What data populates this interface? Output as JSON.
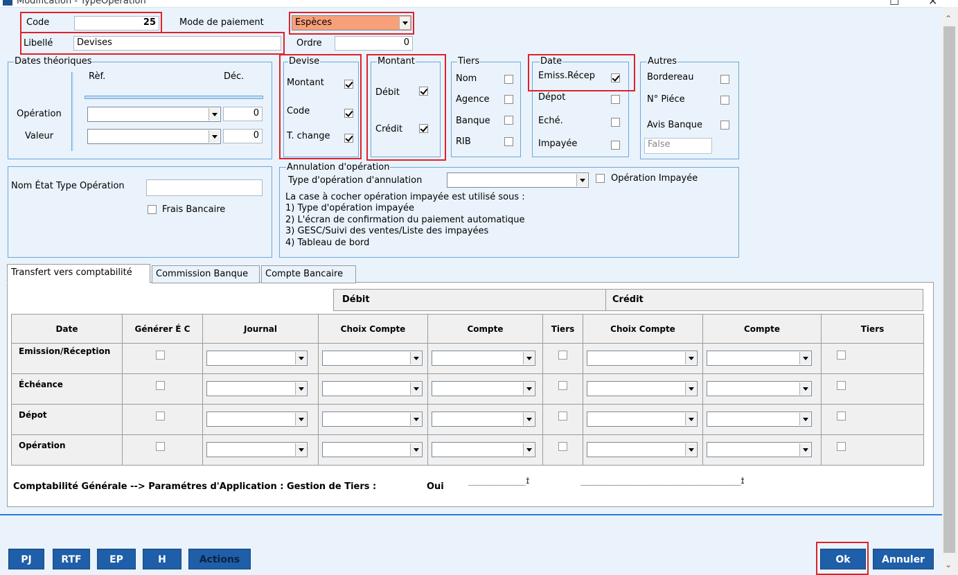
{
  "window": {
    "title": "Modification - TypeOpération",
    "minimize_icon": "minimize-icon",
    "close_icon": "close-icon"
  },
  "header": {
    "code_label": "Code",
    "code_value": "25",
    "mode_label": "Mode de paiement",
    "mode_value": "Espèces",
    "libelle_label": "Libellé",
    "libelle_value": "Devises",
    "ordre_label": "Ordre",
    "ordre_value": "0"
  },
  "dates_theoriques": {
    "legend": "Dates théoriques",
    "ref_label": "Rèf.",
    "dec_label": "Déc.",
    "operation_label": "Opération",
    "operation_dec": "0",
    "valeur_label": "Valeur",
    "valeur_dec": "0"
  },
  "devise": {
    "legend": "Devise",
    "montant_label": "Montant",
    "code_label": "Code",
    "tchange_label": "T. change"
  },
  "montant": {
    "legend": "Montant",
    "debit_label": "Débit",
    "credit_label": "Crédit"
  },
  "tiers": {
    "legend": "Tiers",
    "nom_label": "Nom",
    "agence_label": "Agence",
    "banque_label": "Banque",
    "rib_label": "RIB"
  },
  "date_group": {
    "legend": "Date",
    "emiss_label": "Emiss.Récep",
    "depot_label": "Dépot",
    "eche_label": "Eché.",
    "impayee_label": "Impayée"
  },
  "autres": {
    "legend": "Autres",
    "bordereau_label": "Bordereau",
    "piece_label": "N° Piéce",
    "avis_label": "Avis Banque",
    "avis_value": "False"
  },
  "etat": {
    "nom_label": "Nom État Type Opération",
    "frais_label": "Frais Bancaire"
  },
  "annulation": {
    "legend": "Annulation d'opération",
    "type_label": "Type d'opération d'annulation",
    "impayee_label": "Opération Impayée",
    "note_1": "La case à cocher opération impayée est utilisé sous :",
    "note_2": "1) Type d'opération impayée",
    "note_3": "2) L'écran de confirmation du paiement automatique",
    "note_4": "3) GESC/Suivi des ventes/Liste des impayées",
    "note_5": "4) Tableau de bord"
  },
  "tabs": [
    {
      "label": "Transfert vers comptabilité"
    },
    {
      "label": "Commission Banque"
    },
    {
      "label": "Compte Bancaire"
    }
  ],
  "grid": {
    "debit_header": "Débit",
    "credit_header": "Crédit",
    "columns": [
      "Date",
      "Générer É C",
      "Journal",
      "Choix Compte",
      "Compte",
      "Tiers",
      "Choix Compte",
      "Compte",
      "Tiers"
    ],
    "rows": [
      "Emission/Réception",
      "Échéance",
      "Dépot",
      "Opération"
    ]
  },
  "footer_note": {
    "text": "Comptabilité Générale --> Paramétres d'Application : Gestion de Tiers :",
    "value": "Oui",
    "line_1": "_______________Î",
    "line_2": "______________________________________________Î"
  },
  "buttons": {
    "pj": "PJ",
    "rtf": "RTF",
    "ep": "EP",
    "h": "H",
    "actions": "Actions",
    "ok": "Ok",
    "annuler": "Annuler"
  },
  "colors": {
    "accent": "#1f5ea8",
    "highlight": "#e0202a",
    "mode_fill": "#f7a07a",
    "group_border": "#6aa7dd",
    "background": "#eaf3fb"
  }
}
